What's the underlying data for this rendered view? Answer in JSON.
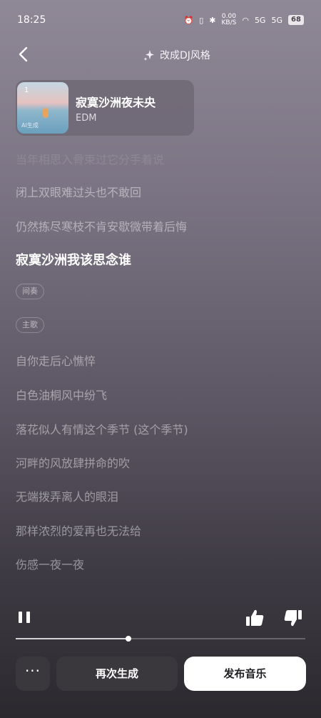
{
  "status_bar": {
    "time": "18:25",
    "net_speed": "0.00",
    "net_unit": "KB/S",
    "signal1": "5G",
    "signal2": "5G",
    "battery": "68"
  },
  "header": {
    "dj_label": "改成DJ风格"
  },
  "song": {
    "title": "寂寞沙洲夜未央",
    "genre": "EDM",
    "cover_number": "1",
    "cover_caption": "AI生成"
  },
  "lyrics": {
    "faded_line": "当年相思入骨束过它分手着说",
    "lines_before": [
      "闭上双眼难过头也不敢回",
      "仍然拣尽寒枝不肯安歇微带着后悔"
    ],
    "active_line": "寂寞沙洲我该思念谁",
    "tags": [
      "间奏",
      "主歌"
    ],
    "lines_after": [
      "自你走后心憔悴",
      "白色油桐风中纷飞",
      "落花似人有情这个季节 (这个季节)",
      "河畔的风放肆拼命的吹",
      "无端拨弄离人的眼泪",
      "那样浓烈的爱再也无法给",
      "伤感一夜一夜"
    ]
  },
  "player": {
    "progress": 0.39
  },
  "actions": {
    "more_label": "···",
    "regenerate_label": "再次生成",
    "publish_label": "发布音乐"
  },
  "colors": {
    "bg_top": "#8f8896",
    "bg_bottom": "#2b292e",
    "button_dark": "#3a373d",
    "button_light": "#ffffff"
  }
}
